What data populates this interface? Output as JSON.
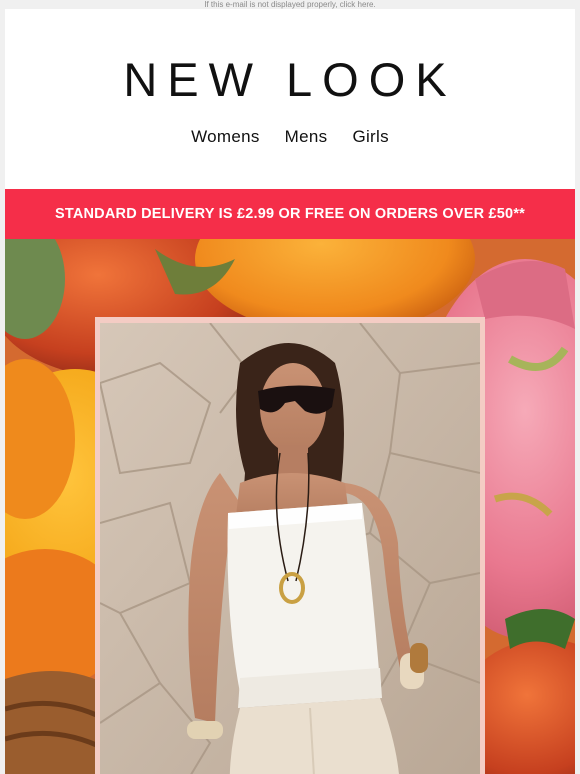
{
  "preheader": {
    "text": "If this e-mail is not displayed properly, click here."
  },
  "brand": {
    "logo_text": "NEW LOOK"
  },
  "nav": {
    "items": [
      {
        "label": "Womens"
      },
      {
        "label": "Mens"
      },
      {
        "label": "Girls"
      }
    ]
  },
  "banner": {
    "text": "STANDARD DELIVERY IS £2.99 OR FREE ON ORDERS OVER £50**",
    "bg_color": "#f52e49"
  },
  "hero": {
    "image_icon": "model-photo-icon",
    "background_icon": "fruit-background-icon"
  }
}
